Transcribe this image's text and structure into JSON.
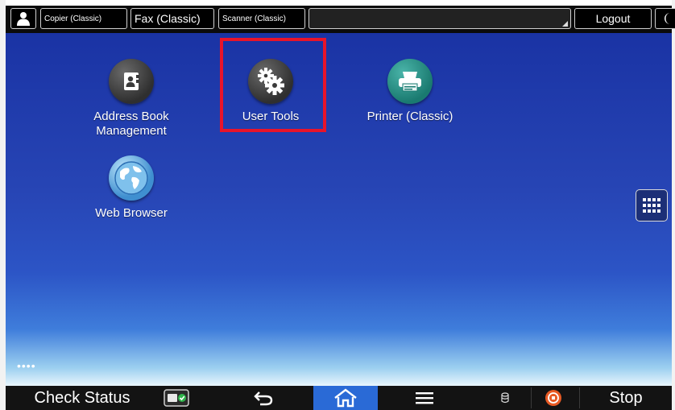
{
  "topbar": {
    "user_icon": "user-icon",
    "copier_label": "Copier (Classic)",
    "fax_label": "Fax (Classic)",
    "scanner_label": "Scanner (Classic)",
    "message_text": "",
    "logout_label": "Logout",
    "moon_icon": "energy-saver-moon-icon"
  },
  "desktop": {
    "apps": [
      {
        "label_line1": "Address Book",
        "label_line2": "Management",
        "icon": "address-book-icon"
      },
      {
        "label_line1": "User Tools",
        "label_line2": "",
        "icon": "gears-icon"
      },
      {
        "label_line1": "Printer (Classic)",
        "label_line2": "",
        "icon": "printer-icon"
      },
      {
        "label_line1": "Web Browser",
        "label_line2": "",
        "icon": "globe-icon"
      }
    ],
    "highlighted_app": "User Tools",
    "highlight_color": "#e8142a",
    "page_indicator": "••••"
  },
  "bottombar": {
    "check_status_label": "Check Status",
    "sd_icon": "sd-card-icon",
    "back_icon": "back-arrow-icon",
    "home_icon": "home-icon",
    "menu_icon": "menu-icon",
    "data_icon": "data-cylinder-icon",
    "stop_icon": "stop-icon",
    "stop_label": "Stop",
    "home_active_color": "#2a6ad6"
  }
}
